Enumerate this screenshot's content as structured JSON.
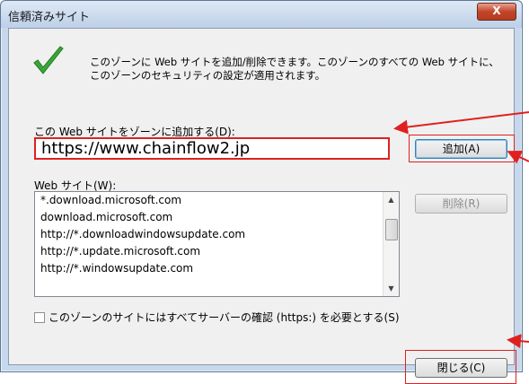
{
  "window": {
    "title": "信頼済みサイト",
    "close_glyph": "X"
  },
  "description": "このゾーンに Web サイトを追加/削除できます。このゾーンのすべての Web サイトに、このゾーンのセキュリティの設定が適用されます。",
  "add_section": {
    "label": "この Web サイトをゾーンに追加する(D):",
    "url_value": "https://www.chainflow2.jp",
    "add_button": "追加(A)"
  },
  "sites_section": {
    "label": "Web サイト(W):",
    "items": [
      "*.download.microsoft.com",
      "download.microsoft.com",
      "http://*.downloadwindowsupdate.com",
      "http://*.update.microsoft.com",
      "http://*.windowsupdate.com"
    ],
    "delete_button": "削除(R)"
  },
  "https_checkbox": {
    "label": "このゾーンのサイトにはすべてサーバーの確認 (https:) を必要とする(S)",
    "checked": false
  },
  "close_button": "閉じる(C)",
  "colors": {
    "annotation_red": "#e02020",
    "check_green": "#3aa63a"
  },
  "icons": {
    "check": "checkmark-icon",
    "scroll_up": "scroll-up-arrow-icon",
    "scroll_down": "scroll-down-arrow-icon"
  }
}
